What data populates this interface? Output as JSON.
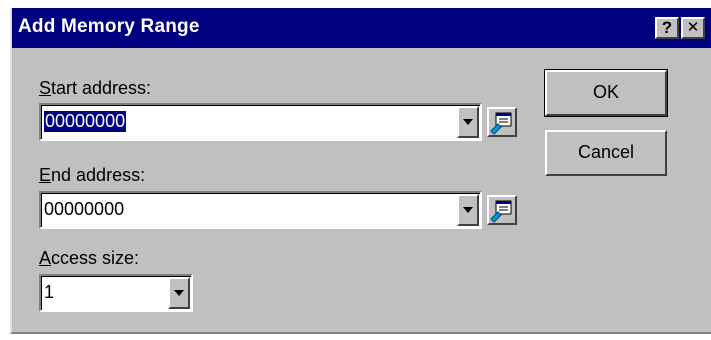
{
  "window": {
    "title": "Add Memory Range",
    "help_label": "?",
    "close_label": "✕"
  },
  "start": {
    "label_u": "S",
    "label_rest": "tart address:",
    "value": "00000000"
  },
  "end": {
    "label_u": "E",
    "label_rest": "nd address:",
    "value": "00000000"
  },
  "access": {
    "label_u": "A",
    "label_rest": "ccess size:",
    "value": "1"
  },
  "buttons": {
    "ok": "OK",
    "cancel": "Cancel"
  },
  "icons": {
    "browse": "browse-memory-icon",
    "dropdown": "chevron-down-icon"
  }
}
